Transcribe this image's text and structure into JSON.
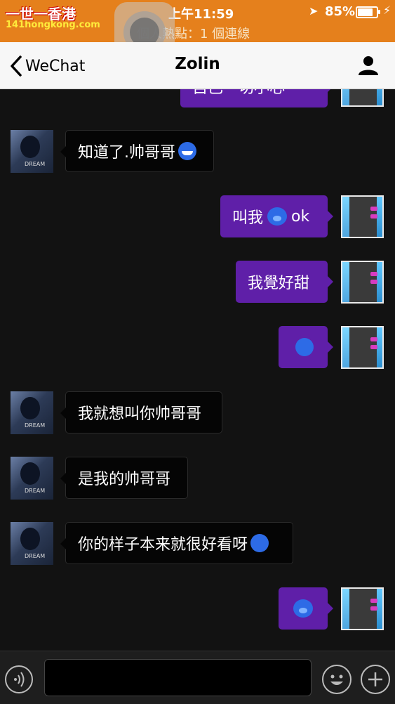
{
  "status_bar": {
    "time": "上午11:59",
    "battery_pct": "85%",
    "battery_level": 0.85,
    "hotspot": "個人熱點：1 個連線",
    "bg_color": "#e5801c"
  },
  "watermark": {
    "line1": "一世一香港",
    "line2": "141hongkong.com"
  },
  "nav": {
    "back_label": "WeChat",
    "title": "Zolin"
  },
  "messages": [
    {
      "dir": "out",
      "text": "自己一切小心",
      "emoji": null
    },
    {
      "dir": "in",
      "text": "知道了.帅哥哥",
      "emoji": "grinning-face"
    },
    {
      "dir": "out",
      "text": "叫我",
      "emoji": "pig-face",
      "text_after": "ok"
    },
    {
      "dir": "out",
      "text": "我覺好甜",
      "emoji": null
    },
    {
      "dir": "out",
      "text": "",
      "emoji": "face-with-tongue"
    },
    {
      "dir": "in",
      "text": "我就想叫你帅哥哥",
      "emoji": null
    },
    {
      "dir": "in",
      "text": "是我的帅哥哥",
      "emoji": null
    },
    {
      "dir": "in",
      "text": "你的样子本来就很好看呀",
      "emoji": "winking-tongue-face"
    },
    {
      "dir": "out",
      "text": "",
      "emoji": "pig-face"
    }
  ],
  "colors": {
    "incoming_bubble": "#050505",
    "outgoing_bubble": "#5f1fa8",
    "chat_bg": "#121212"
  }
}
